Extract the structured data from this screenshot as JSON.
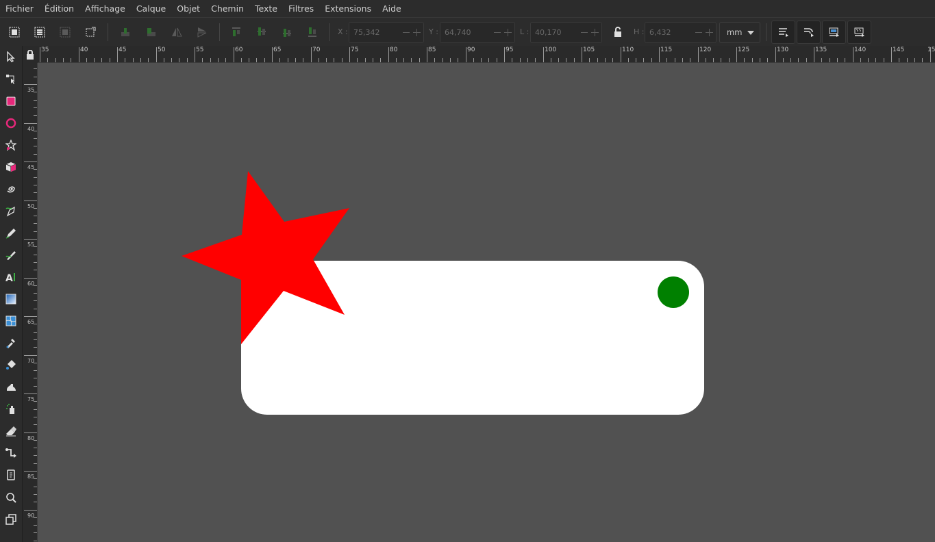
{
  "menu": {
    "items": [
      "Fichier",
      "Édition",
      "Affichage",
      "Calque",
      "Objet",
      "Chemin",
      "Texte",
      "Filtres",
      "Extensions",
      "Aide"
    ]
  },
  "toolbar": {
    "x": {
      "label": "X :",
      "value": "75,342"
    },
    "y": {
      "label": "Y :",
      "value": "64,740"
    },
    "w": {
      "label": "L :",
      "value": "40,170"
    },
    "h": {
      "label": "H :",
      "value": "6,432"
    },
    "unit": "mm"
  },
  "ruler": {
    "top_labels": [
      "35",
      "40",
      "45",
      "50",
      "55",
      "60",
      "65",
      "70",
      "75",
      "80",
      "85",
      "90",
      "95",
      "100",
      "105",
      "110",
      "115",
      "120",
      "125",
      "130",
      "135",
      "140",
      "145",
      "15"
    ],
    "left_labels": [
      "35",
      "40",
      "45",
      "50",
      "55",
      "60",
      "65",
      "70",
      "75",
      "80",
      "85",
      "90"
    ]
  },
  "canvas": {
    "background": "#515151",
    "rect_fill": "#ffffff",
    "star_fill": "#ff0000",
    "circle_fill": "#008000"
  },
  "tools": [
    "selector-icon",
    "node-icon",
    "rectangle-icon",
    "ellipse-icon",
    "star-icon",
    "box3d-icon",
    "spiral-icon",
    "pen-icon",
    "pencil-icon",
    "calligraphy-icon",
    "text-icon",
    "gradient-icon",
    "mesh-icon",
    "dropper-icon",
    "paint-bucket-icon",
    "tweak-icon",
    "spray-icon",
    "eraser-icon",
    "connector-icon",
    "pages-icon",
    "zoom-icon",
    "clone-icon"
  ]
}
